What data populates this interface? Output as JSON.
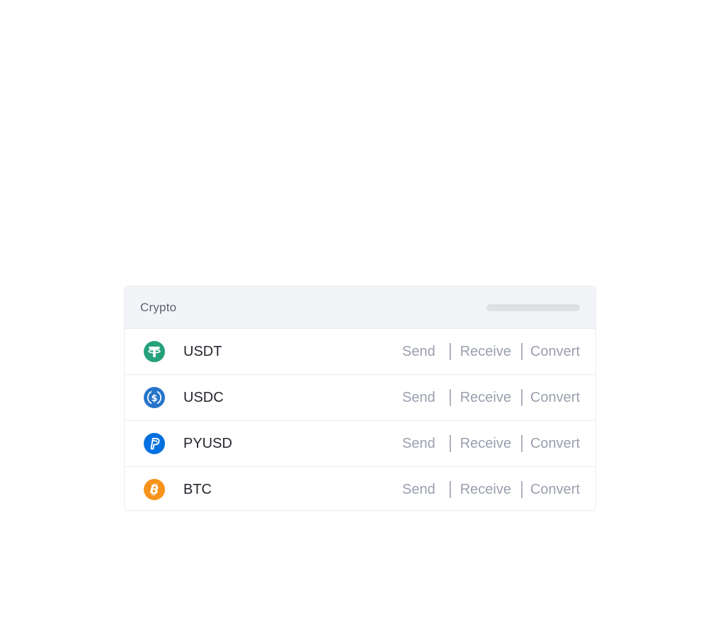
{
  "panel": {
    "title": "Crypto"
  },
  "coins": [
    {
      "symbol": "USDT",
      "icon": "tether-icon",
      "color": "#26a17b"
    },
    {
      "symbol": "USDC",
      "icon": "usdc-icon",
      "color": "#2775ca"
    },
    {
      "symbol": "PYUSD",
      "icon": "paypal-icon",
      "color": "#0070e0"
    },
    {
      "symbol": "BTC",
      "icon": "bitcoin-icon",
      "color": "#f7931a"
    }
  ],
  "actions": {
    "send": "Send",
    "receive": "Receive",
    "convert": "Convert"
  }
}
